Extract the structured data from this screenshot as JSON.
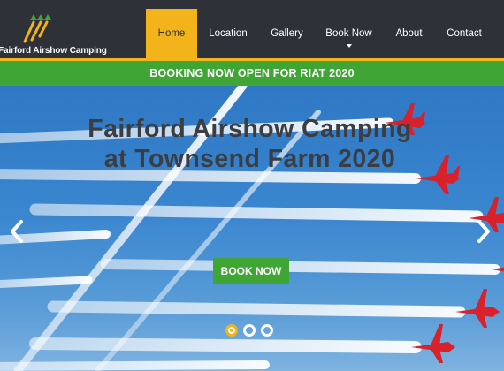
{
  "site": {
    "logo_text": "Fairford Airshow Camping"
  },
  "nav": {
    "items": [
      {
        "label": "Home"
      },
      {
        "label": "Location"
      },
      {
        "label": "Gallery"
      },
      {
        "label": "Book Now"
      },
      {
        "label": "About"
      },
      {
        "label": "Contact"
      }
    ]
  },
  "banner": {
    "text": "BOOKING NOW OPEN FOR RIAT 2020"
  },
  "hero": {
    "title_line1": "Fairford Airshow Camping",
    "title_line2": "at Townsend Farm 2020",
    "cta_label": "BOOK NOW",
    "prev_icon": "chevron-left-icon",
    "next_icon": "chevron-right-icon"
  },
  "carousel": {
    "slide_count": 3,
    "active_index": 0
  },
  "colors": {
    "header_bg": "#2e3238",
    "accent_yellow": "#f3b31b",
    "accent_green": "#3fa535",
    "sky_blue": "#3a86cf",
    "jet_red": "#d8212a"
  }
}
